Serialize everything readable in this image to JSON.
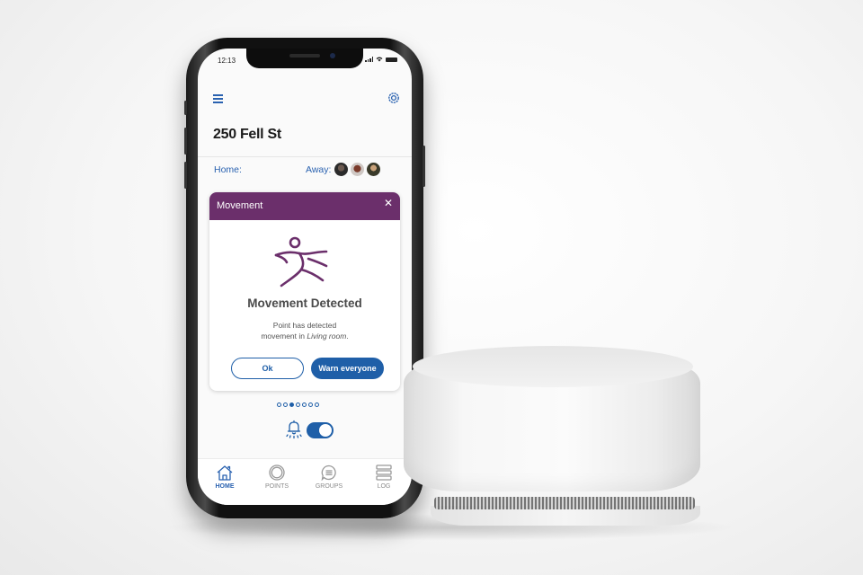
{
  "status_bar": {
    "time": "12:13"
  },
  "header": {
    "menu_icon": "hamburger-menu-icon",
    "settings_icon": "gear-icon",
    "title": "250 Fell St"
  },
  "presence": {
    "home_label": "Home:",
    "away_label": "Away:",
    "away_avatars": [
      "avatar-1",
      "avatar-2",
      "avatar-3"
    ]
  },
  "alert_card": {
    "header_label": "Movement",
    "close_icon": "close-icon",
    "icon": "running-person-icon",
    "title": "Movement Detected",
    "message_line1": "Point has detected",
    "message_line2_prefix": "movement in ",
    "message_room": "Living room",
    "message_suffix": ".",
    "ok_label": "Ok",
    "warn_label": "Warn everyone",
    "accent_color": "#6b2f6b"
  },
  "pager": {
    "count": 7,
    "active_index": 2
  },
  "alarm": {
    "icon": "alarm-bell-icon",
    "toggle_on": true
  },
  "tabbar": {
    "items": [
      {
        "label": "HOME",
        "icon": "home-icon",
        "active": true
      },
      {
        "label": "POINTS",
        "icon": "points-ring-icon",
        "active": false
      },
      {
        "label": "GROUPS",
        "icon": "chat-bubble-icon",
        "active": false
      },
      {
        "label": "LOG",
        "icon": "list-icon",
        "active": false
      }
    ]
  },
  "colors": {
    "primary": "#1f5fa8",
    "link": "#2a62b0",
    "purple": "#6b2f6b"
  }
}
